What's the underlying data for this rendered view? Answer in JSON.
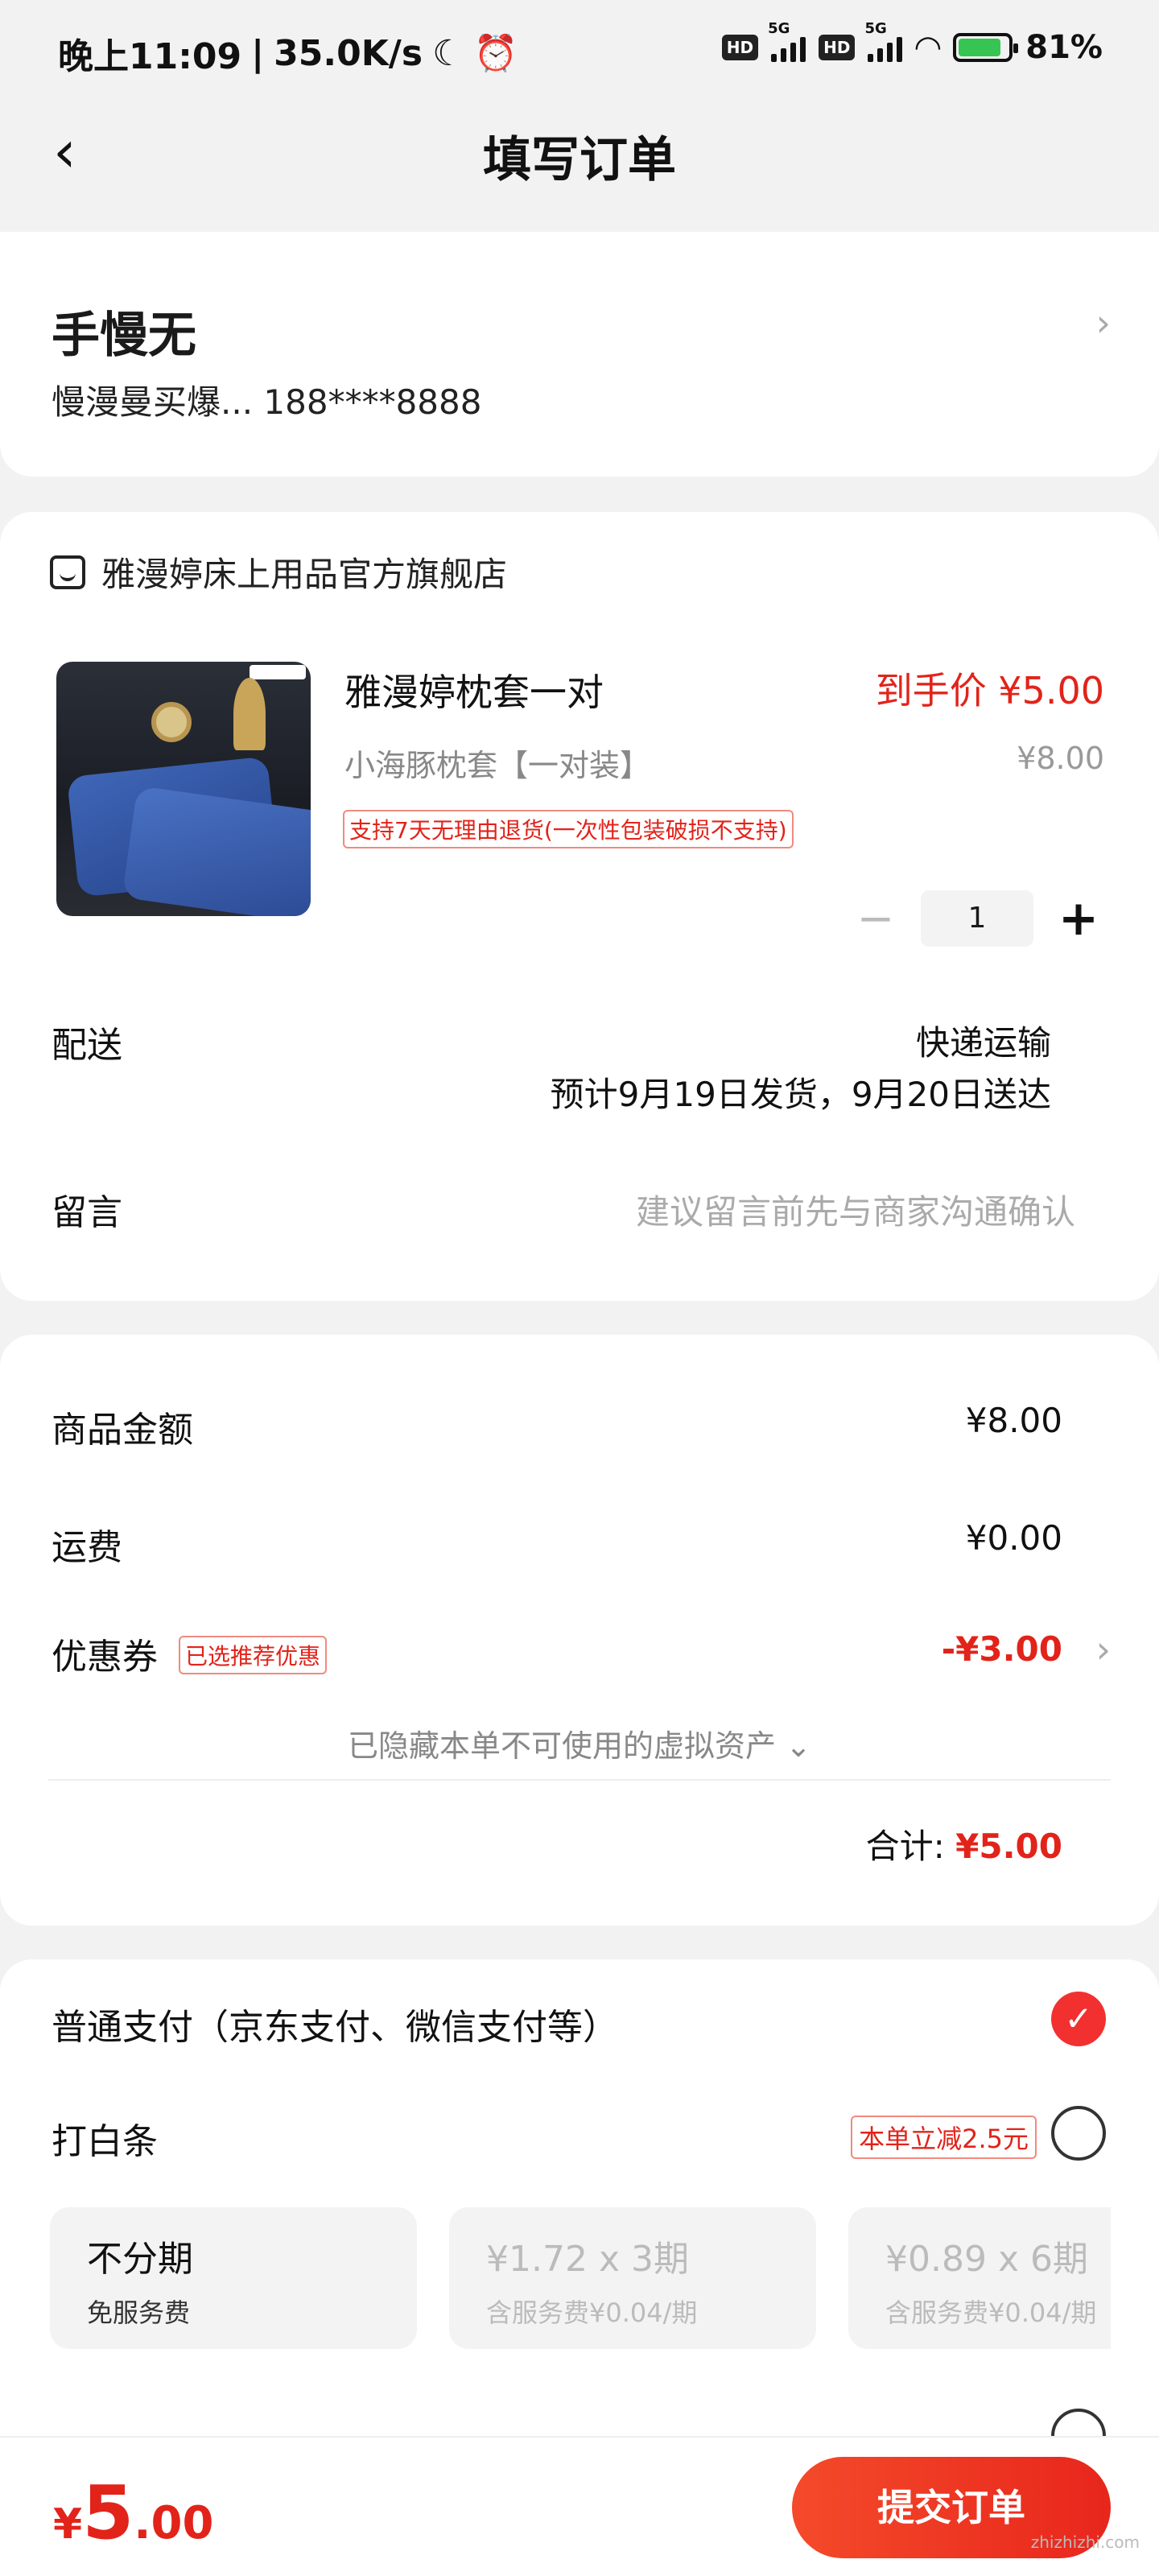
{
  "status_bar": {
    "time": "晚上11:09",
    "net_speed": "35.0K/s",
    "battery": "81%"
  },
  "header": {
    "title": "填写订单"
  },
  "address": {
    "name": "手慢无",
    "detail": "慢漫曼买爆...  188****8888"
  },
  "store": {
    "name": "雅漫婷床上用品官方旗舰店",
    "product": {
      "title": "雅漫婷枕套一对",
      "final_price": "到手价 ¥5.00",
      "spec": "小海豚枕套【一对装】",
      "orig_price": "¥8.00",
      "return_tag": "支持7天无理由退货(一次性包装破损不支持)",
      "quantity": "1"
    },
    "delivery_label": "配送",
    "delivery_method": "快递运输",
    "delivery_eta": "预计9月19日发货，9月20日送达",
    "note_label": "留言",
    "note_placeholder": "建议留言前先与商家沟通确认"
  },
  "summary": {
    "goods_label": "商品金额",
    "goods_value": "¥8.00",
    "freight_label": "运费",
    "freight_value": "¥0.00",
    "coupon_label": "优惠券",
    "coupon_tag": "已选推荐优惠",
    "coupon_value": "-¥3.00",
    "hidden_assets": "已隐藏本单不可使用的虚拟资产",
    "total_label": "合计:",
    "total_value": "¥5.00"
  },
  "payment": {
    "normal": "普通支付（京东支付、微信支付等）",
    "baitiao": "打白条",
    "baitiao_promo": "本单立减2.5元",
    "installments": [
      {
        "title": "不分期",
        "sub": "免服务费"
      },
      {
        "title": "¥1.72 x 3期",
        "sub": "含服务费¥0.04/期"
      },
      {
        "title": "¥0.89 x 6期",
        "sub": "含服务费¥0.04/期"
      }
    ]
  },
  "bottom": {
    "currency": "¥",
    "amount_int": "5",
    "amount_dec": ".00",
    "submit": "提交订单",
    "watermark": "zhizhizhi.com"
  },
  "colors": {
    "accent": "#e2231a",
    "check": "#f23030"
  }
}
